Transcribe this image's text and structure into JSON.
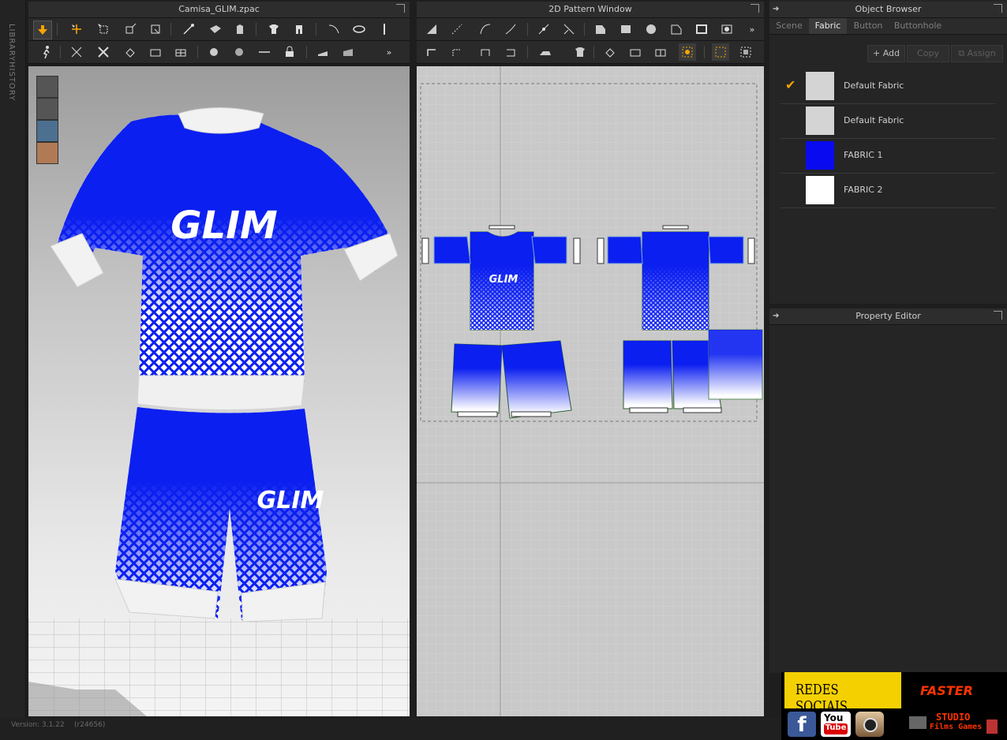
{
  "side_tabs": {
    "library": "LIBRARY",
    "history": "HISTORY"
  },
  "view3d": {
    "title": "Camisa_GLIM.zpac"
  },
  "view2d": {
    "title": "2D Pattern Window"
  },
  "object_browser": {
    "title": "Object Browser",
    "tabs": [
      "Scene",
      "Fabric",
      "Button",
      "Buttonhole"
    ],
    "active_tab": "Fabric",
    "buttons": {
      "add": "Add",
      "copy": "Copy",
      "assign": "Assign"
    },
    "fabrics": [
      {
        "name": "Default Fabric",
        "color": "#d4d4d4",
        "checked": true
      },
      {
        "name": "Default Fabric",
        "color": "#d4d4d4",
        "checked": false
      },
      {
        "name": "FABRIC 1",
        "color": "#0a0af0",
        "checked": false
      },
      {
        "name": "FABRIC 2",
        "color": "#ffffff",
        "checked": false
      }
    ]
  },
  "property_editor": {
    "title": "Property Editor"
  },
  "status": {
    "version": "Version: 3.1.22",
    "build": "(r24656)"
  },
  "garment": {
    "logo_text": "GLIM",
    "primary_color": "#0b1ff0",
    "trim_color": "#f2f2f2"
  },
  "social": {
    "title": "REDES SOCIAIS",
    "brand": "FASTER",
    "studio": "STUDIO",
    "sub": "Films Games",
    "yt_line1": "You",
    "yt_line2": "Tube",
    "fb_letter": "f"
  }
}
